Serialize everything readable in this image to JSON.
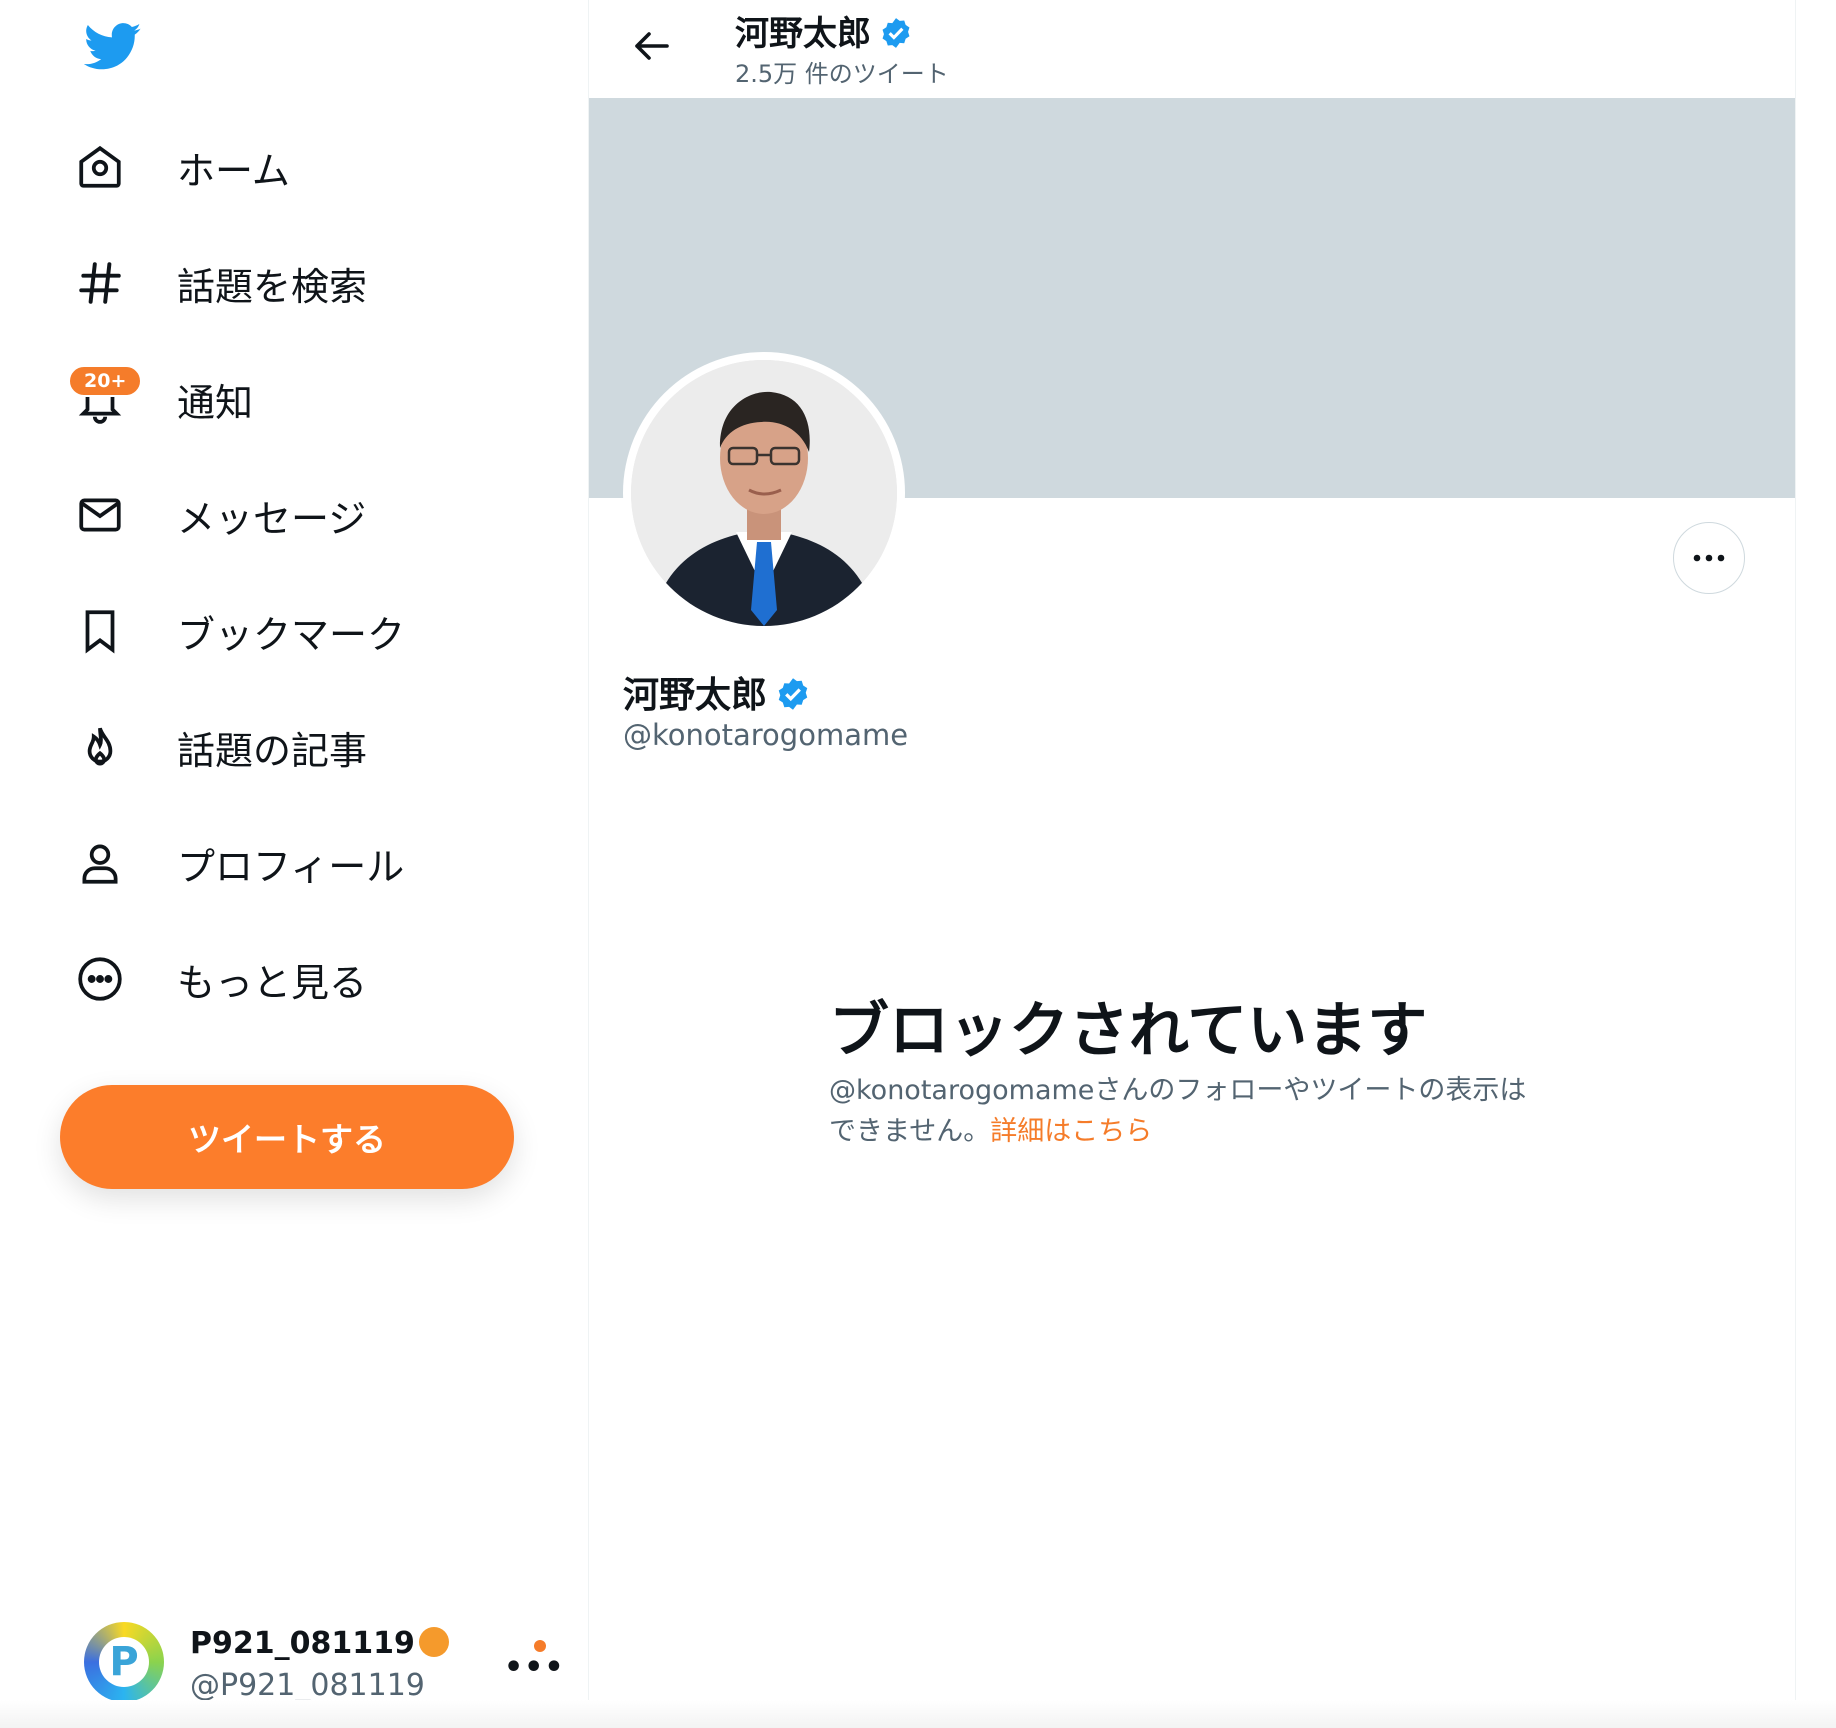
{
  "sidebar": {
    "logo_icon": "twitter-bird-icon",
    "items": [
      {
        "label": "ホーム",
        "icon": "home-icon"
      },
      {
        "label": "話題を検索",
        "icon": "hashtag-icon"
      },
      {
        "label": "通知",
        "icon": "bell-icon",
        "badge": "20+"
      },
      {
        "label": "メッセージ",
        "icon": "mail-icon"
      },
      {
        "label": "ブックマーク",
        "icon": "bookmark-icon"
      },
      {
        "label": "話題の記事",
        "icon": "fire-icon"
      },
      {
        "label": "プロフィール",
        "icon": "person-icon"
      },
      {
        "label": "もっと見る",
        "icon": "more-circle-icon"
      }
    ],
    "tweet_button": "ツイートする",
    "account": {
      "name": "P921_081119",
      "handle": "@P921_081119",
      "avatar_letter": "P"
    }
  },
  "header": {
    "name": "河野太郎",
    "tweet_count": "2.5万 件のツイート"
  },
  "profile": {
    "name": "河野太郎",
    "handle": "@konotarogomame"
  },
  "blocked": {
    "title": "ブロックされています",
    "message": "@konotarogomameさんのフォローやツイートの表示はできません。",
    "link": "詳細はこちら"
  },
  "colors": {
    "accent": "#fc7d2b",
    "verified": "#1d9bf0",
    "twitter_blue": "#1d9bf0",
    "banner": "#cfd9de",
    "secondary_text": "#536471"
  }
}
